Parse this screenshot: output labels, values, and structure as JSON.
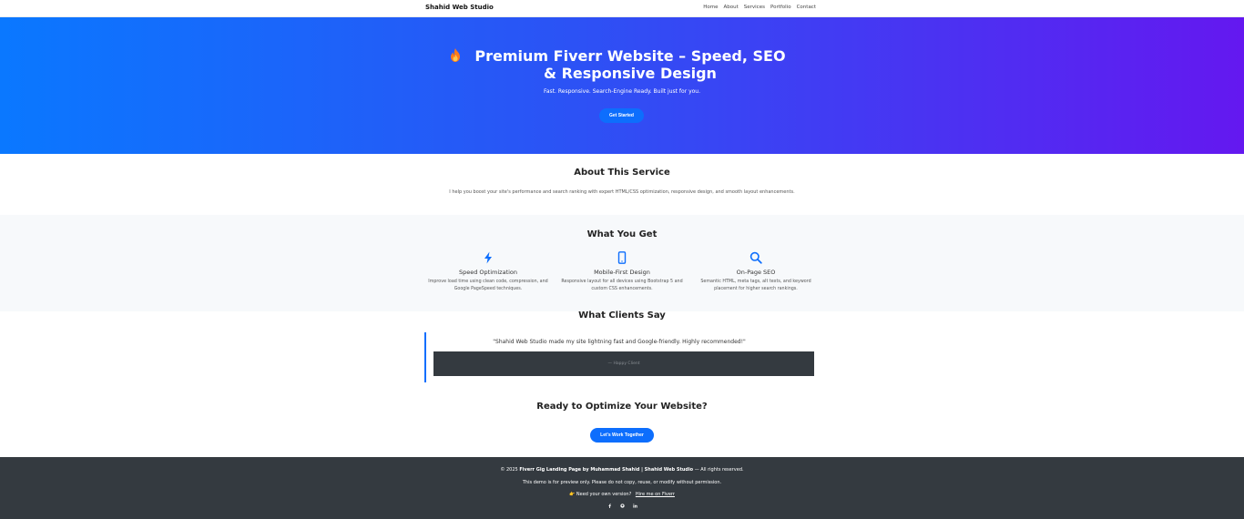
{
  "navbar": {
    "brand": "Shahid Web Studio",
    "links": [
      "Home",
      "About",
      "Services",
      "Portfolio",
      "Contact"
    ]
  },
  "hero": {
    "icon": "fire-icon",
    "title": "Premium Fiverr Website – Speed, SEO & Responsive Design",
    "subtitle": "Fast. Responsive. Search-Engine Ready. Built just for you.",
    "button_label": "Get Started"
  },
  "about": {
    "title": "About This Service",
    "text": "I help you boost your site's performance and search ranking with expert HTML/CSS optimization, responsive design, and smooth layout enhancements."
  },
  "features": {
    "title": "What You Get",
    "items": [
      {
        "icon": "lightning-icon",
        "title": "Speed Optimization",
        "desc": "Improve load time using clean code, compression, and Google PageSpeed techniques."
      },
      {
        "icon": "mobile-icon",
        "title": "Mobile-First Design",
        "desc": "Responsive layout for all devices using Bootstrap 5 and custom CSS enhancements."
      },
      {
        "icon": "search-icon",
        "title": "On-Page SEO",
        "desc": "Semantic HTML, meta tags, alt texts, and keyword placement for higher search rankings."
      }
    ]
  },
  "testimonials": {
    "title": "What Clients Say",
    "quote": "\"Shahid Web Studio made my site lightning fast and Google-friendly. Highly recommended!\"",
    "author": "— Happy Client"
  },
  "cta": {
    "title": "Ready to Optimize Your Website?",
    "button_label": "Let's Work Together"
  },
  "footer": {
    "copyright_prefix": "© 2025",
    "copyright_bold": "Fiverr Gig Landing Page by Muhammad Shahid | Shahid Web Studio",
    "copyright_suffix": "— All rights reserved.",
    "notice": "This demo is for preview only. Please do not copy, reuse, or modify without permission.",
    "hire_prompt": "👉 Need your own version?",
    "hire_link": "Hire me on Fiverr",
    "social": [
      "facebook-icon",
      "github-icon",
      "linkedin-icon"
    ]
  },
  "colors": {
    "accent": "#0d6efd",
    "hero_gradient_start": "#0a78ff",
    "hero_gradient_end": "#6418f0",
    "footer_bg": "#343a40"
  }
}
